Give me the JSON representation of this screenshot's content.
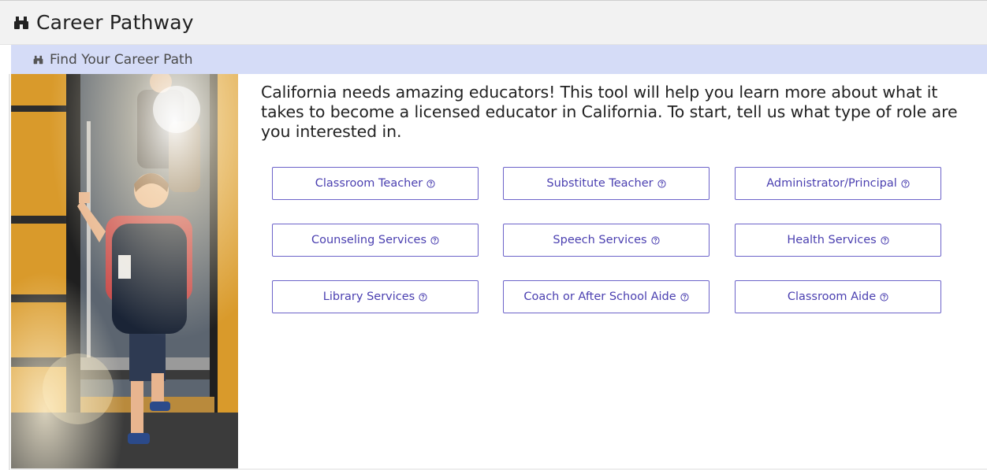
{
  "header": {
    "title": "Career Pathway",
    "icon": "binoculars-icon"
  },
  "subheader": {
    "title": "Find Your Career Path",
    "icon": "binoculars-icon"
  },
  "intro": {
    "text": "California needs amazing educators!  This tool will help you learn more about what it takes to become a licensed educator in California. To start, tell us what type of role are you interested in."
  },
  "roles": [
    {
      "label": "Classroom Teacher"
    },
    {
      "label": "Substitute Teacher"
    },
    {
      "label": "Administrator/Principal"
    },
    {
      "label": "Counseling Services"
    },
    {
      "label": "Speech Services"
    },
    {
      "label": "Health Services"
    },
    {
      "label": "Library Services"
    },
    {
      "label": "Coach or After School Aide"
    },
    {
      "label": "Classroom Aide"
    }
  ],
  "colors": {
    "accent": "#4a3fb0",
    "button_border": "#6c63c9",
    "subheader_bg": "#d5dcf7",
    "header_bg": "#f2f2f2"
  }
}
